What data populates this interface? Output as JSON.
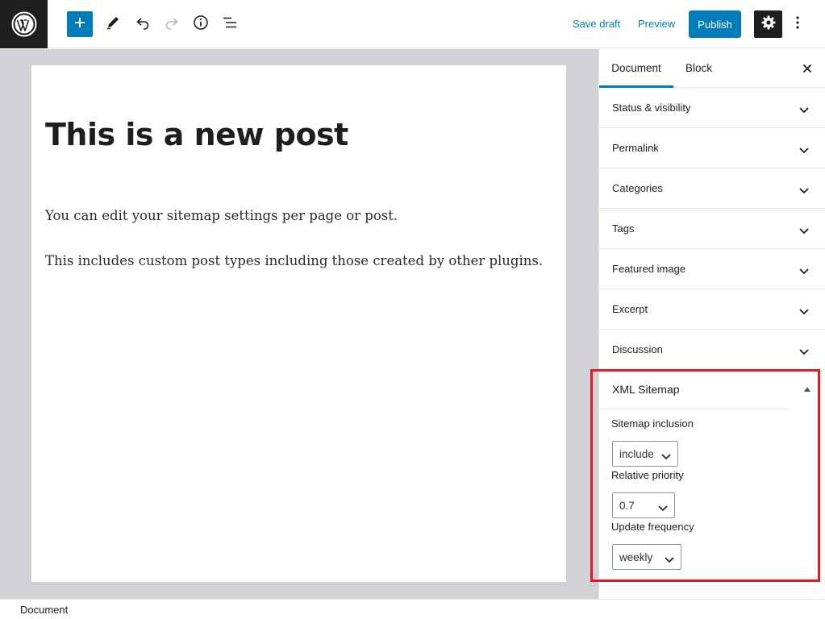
{
  "toolbar": {
    "save_draft": "Save draft",
    "preview": "Preview",
    "publish": "Publish",
    "icons": [
      "wordpress-logo",
      "plus-icon",
      "pencil-icon",
      "undo-icon",
      "redo-icon",
      "info-icon",
      "list-view-icon",
      "gear-icon",
      "more-vertical-icon"
    ]
  },
  "post": {
    "title": "This is a new post",
    "paragraphs": [
      "You can edit your sitemap settings per page or post.",
      "This  includes custom post types including those created by other plugins."
    ]
  },
  "sidebar": {
    "tabs": [
      "Document",
      "Block"
    ],
    "active_tab": "Document",
    "panels": [
      "Status & visibility",
      "Permalink",
      "Categories",
      "Tags",
      "Featured image",
      "Excerpt",
      "Discussion"
    ],
    "xml_sitemap": {
      "title": "XML Sitemap",
      "inclusion_label": "Sitemap inclusion",
      "inclusion_value": "include",
      "priority_label": "Relative priority",
      "priority_value": "0.7",
      "frequency_label": "Update frequency",
      "frequency_value": "weekly"
    }
  },
  "footer": {
    "breadcrumb": "Document"
  },
  "colors": {
    "accent": "#007cba",
    "dark": "#1e1e1e",
    "highlight": "#e01b24",
    "canvas": "#d0d2d6"
  }
}
